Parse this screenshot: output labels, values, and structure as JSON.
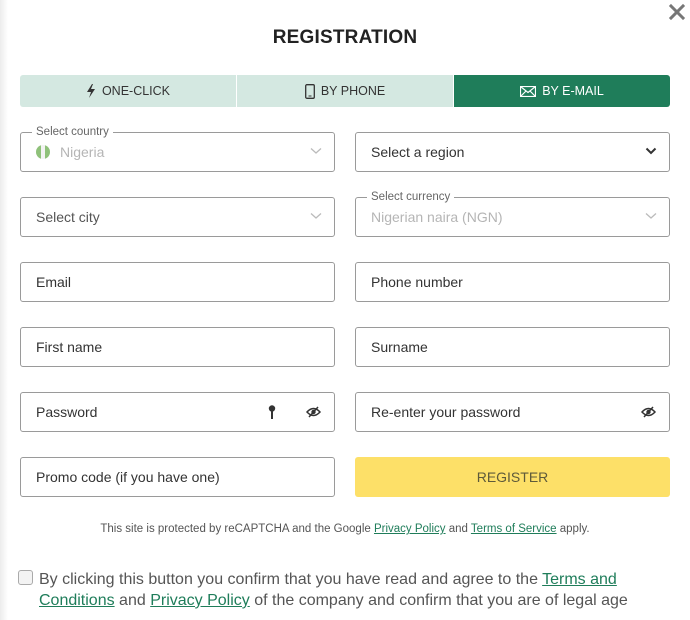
{
  "title": "REGISTRATION",
  "close_icon": "close-icon",
  "tabs": [
    {
      "label": "ONE-CLICK",
      "icon": "lightning-icon",
      "active": false
    },
    {
      "label": "BY PHONE",
      "icon": "phone-icon",
      "active": false
    },
    {
      "label": "BY E-MAIL",
      "icon": "envelope-icon",
      "active": true
    }
  ],
  "fields": {
    "country": {
      "legend": "Select country",
      "value": "Nigeria"
    },
    "region": {
      "placeholder": "Select a region"
    },
    "city": {
      "placeholder": "Select city"
    },
    "currency": {
      "legend": "Select currency",
      "value": "Nigerian naira (NGN)"
    },
    "email": {
      "placeholder": "Email"
    },
    "phone": {
      "placeholder": "Phone number"
    },
    "first_name": {
      "placeholder": "First name"
    },
    "surname": {
      "placeholder": "Surname"
    },
    "password": {
      "placeholder": "Password"
    },
    "password_repeat": {
      "placeholder": "Re-enter your password"
    },
    "promo": {
      "placeholder": "Promo code (if you have one)"
    }
  },
  "register_label": "REGISTER",
  "recaptcha": {
    "prefix": "This site is protected by reCAPTCHA and the Google ",
    "privacy_link": "Privacy Policy",
    "and": " and ",
    "terms_link": "Terms of Service",
    "suffix": " apply."
  },
  "agreement": {
    "checked": false,
    "prefix": "By clicking this button you confirm that you have read and agree to the ",
    "terms_link": "Terms and Conditions",
    "and": " and ",
    "privacy_link": "Privacy Policy",
    "suffix": " of the company and confirm that you are of legal age"
  },
  "colors": {
    "accent": "#1f7d5a",
    "tab_inactive": "#d4e8e1",
    "register_button": "#fde068",
    "flag_green": "#8fc17a"
  }
}
